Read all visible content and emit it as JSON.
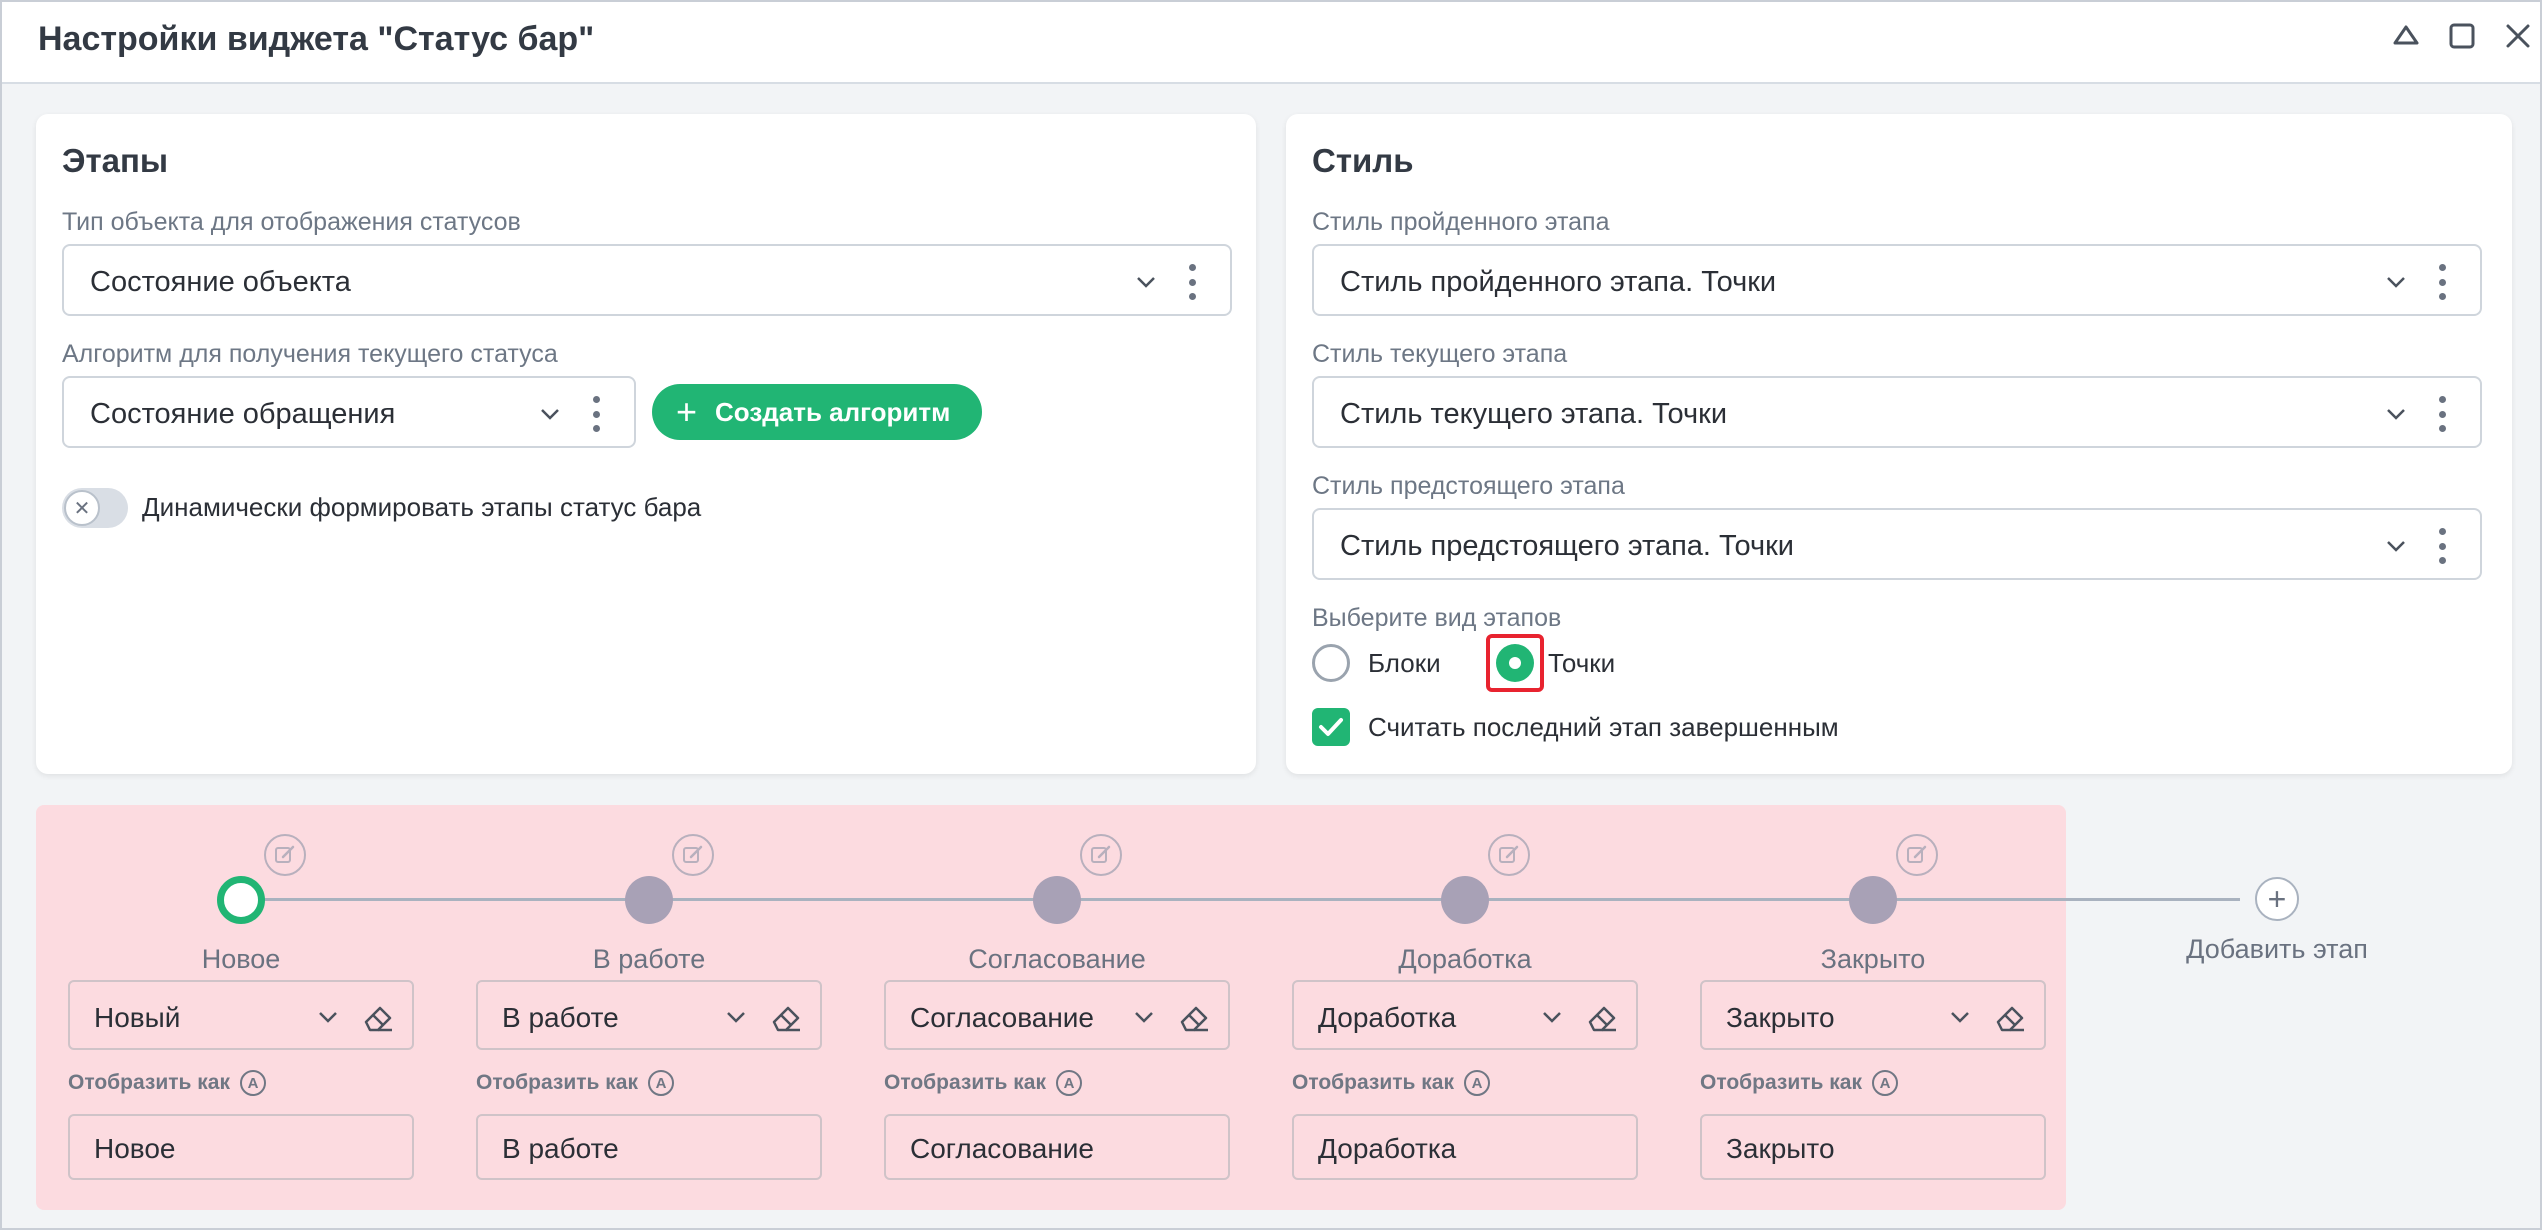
{
  "window": {
    "title": "Настройки виджета \"Статус бар\"",
    "controls": [
      "collapse-icon",
      "maximize-icon",
      "close-icon"
    ]
  },
  "stages_card": {
    "title": "Этапы",
    "object_type_label": "Тип объекта для отображения статусов",
    "object_type_value": "Состояние объекта",
    "algorithm_label": "Алгоритм для получения текущего статуса",
    "algorithm_value": "Состояние обращения",
    "create_algorithm_label": "Создать алгоритм",
    "dynamic_toggle_label": "Динамически формировать этапы статус бара",
    "dynamic_toggle_on": false
  },
  "style_card": {
    "title": "Стиль",
    "passed_label": "Стиль пройденного этапа",
    "passed_value": "Стиль пройденного этапа. Точки",
    "current_label": "Стиль текущего этапа",
    "current_value": "Стиль текущего этапа. Точки",
    "upcoming_label": "Стиль предстоящего этапа",
    "upcoming_value": "Стиль предстоящего этапа. Точки",
    "view_label": "Выберите вид этапов",
    "view_options": [
      "Блоки",
      "Точки"
    ],
    "view_selected": "Точки",
    "last_completed_label": "Считать последний этап завершенным",
    "last_completed_checked": true
  },
  "stage_bar": {
    "display_as_label": "Отобразить как",
    "display_as_badge": "A",
    "add_stage_label": "Добавить этап",
    "stages": [
      {
        "name": "Новое",
        "status": "Новый",
        "display": "Новое",
        "current": true
      },
      {
        "name": "В работе",
        "status": "В работе",
        "display": "В работе",
        "current": false
      },
      {
        "name": "Согласование",
        "status": "Согласование",
        "display": "Согласование",
        "current": false
      },
      {
        "name": "Доработка",
        "status": "Доработка",
        "display": "Доработка",
        "current": false
      },
      {
        "name": "Закрыто",
        "status": "Закрыто",
        "display": "Закрыто",
        "current": false
      }
    ]
  },
  "colors": {
    "accent": "#21b574",
    "highlight": "#e8232f",
    "stage_area": "#fcdbe0",
    "dot_inactive": "#a8a1b6"
  }
}
